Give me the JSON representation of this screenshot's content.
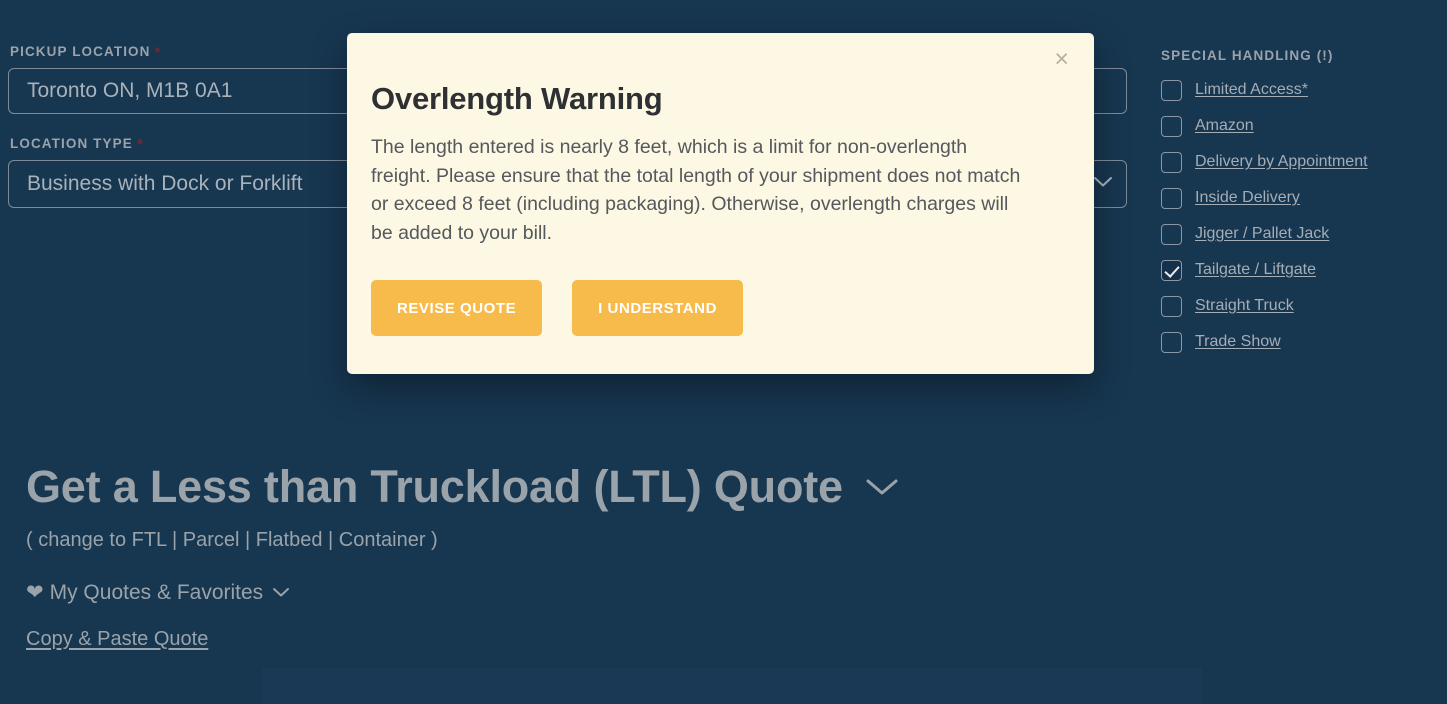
{
  "page": {
    "background_color": "#173650"
  },
  "form": {
    "pickup": {
      "label": "PICKUP LOCATION",
      "required_marker": "*",
      "value": "Toronto ON, M1B 0A1"
    },
    "location_type": {
      "label": "LOCATION TYPE",
      "required_marker": "*",
      "value": "Business with Dock or Forklift",
      "chevron_icon": "chevron-down-icon"
    }
  },
  "special_handling": {
    "title": "SPECIAL HANDLING (!)",
    "options": [
      {
        "label": "Limited Access*",
        "checked": false
      },
      {
        "label": "Amazon",
        "checked": false
      },
      {
        "label": "Delivery by Appointment",
        "checked": false
      },
      {
        "label": "Inside Delivery",
        "checked": false
      },
      {
        "label": "Jigger / Pallet Jack",
        "checked": false
      },
      {
        "label": "Tailgate / Liftgate",
        "checked": true
      },
      {
        "label": "Straight Truck",
        "checked": false
      },
      {
        "label": "Trade Show",
        "checked": false
      }
    ]
  },
  "lower": {
    "heading": "Get a Less than Truckload (LTL) Quote",
    "heading_chevron_icon": "chevron-down-icon",
    "change_line": "( change to FTL | Parcel | Flatbed | Container )",
    "favorites_label": "My Quotes & Favorites",
    "favorites_heart_icon": "heart-icon",
    "favorites_chevron_icon": "chevron-down-icon",
    "copy_paste_link": "Copy & Paste Quote"
  },
  "modal": {
    "title": "Overlength Warning",
    "body": "The length entered is nearly 8 feet, which is a limit for non-overlength freight. Please ensure that the total length of your shipment does not match or exceed 8 feet (including packaging). Otherwise, overlength charges will be added to your bill.",
    "close_icon": "close-icon",
    "close_glyph": "×",
    "primary_button": "REVISE QUOTE",
    "secondary_button": "I UNDERSTAND",
    "button_color": "#f6bb4b",
    "background_color": "#fdf8e3"
  }
}
